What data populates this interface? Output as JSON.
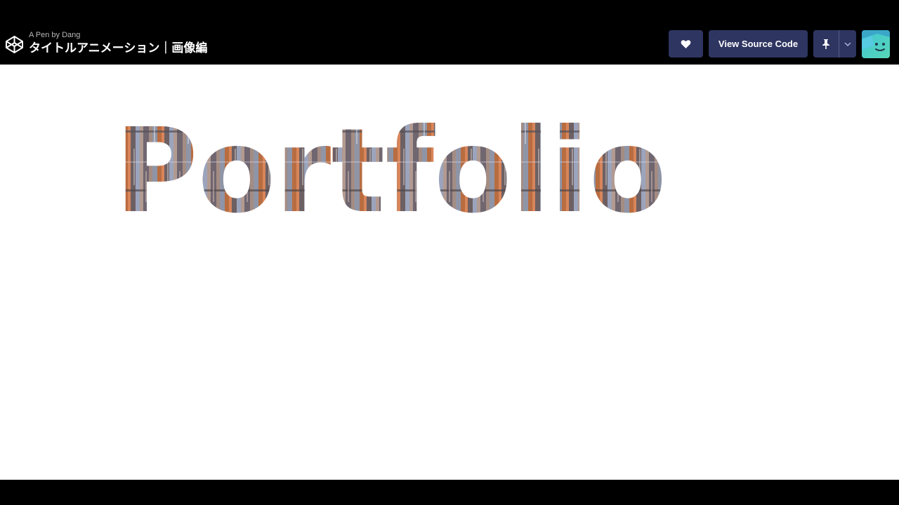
{
  "header": {
    "subtitle": "A Pen by Dang",
    "title": "タイトルアニメーション｜画像編",
    "view_source_label": "View Source Code"
  },
  "preview": {
    "headline": "Portfolio"
  },
  "icons": {
    "logo": "codepen-logo-icon",
    "like": "heart-icon",
    "pin": "pin-icon",
    "more": "chevron-down-icon",
    "user": "avatar"
  },
  "colors": {
    "top_bar": "#000000",
    "button": "#2f3561",
    "preview_background": "#ffffff",
    "avatar_gradient_start": "#40c5d6",
    "avatar_gradient_end": "#57d6b6"
  }
}
